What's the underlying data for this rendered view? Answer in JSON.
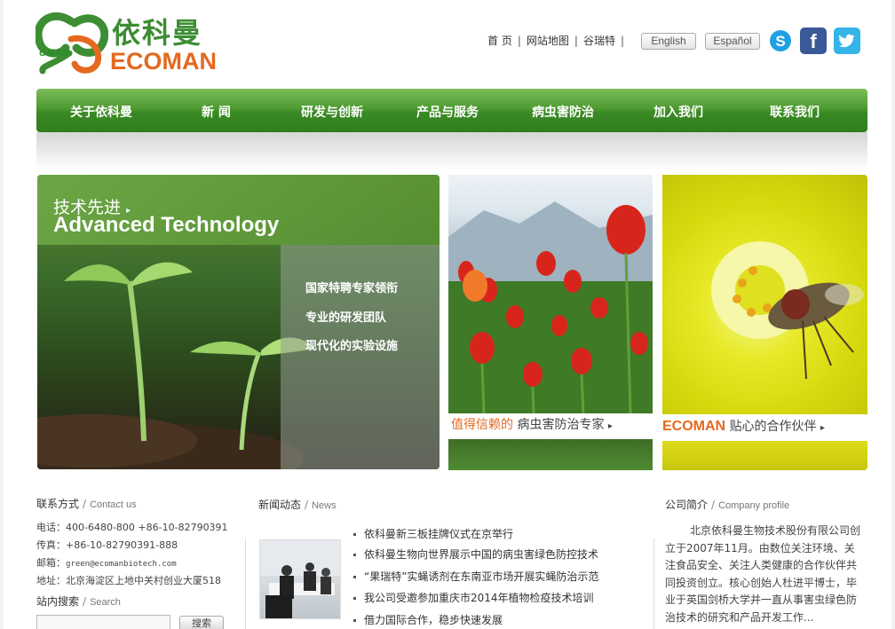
{
  "logo": {
    "cn": "依科曼",
    "en": "ECOMAN",
    "mark_text": "OMAN"
  },
  "toplinks": [
    {
      "label": "首 页"
    },
    {
      "label": "网站地图"
    },
    {
      "label": "谷瑞特"
    }
  ],
  "lang": {
    "english": "English",
    "espanol": "Español"
  },
  "social": {
    "facebook": "f"
  },
  "nav": [
    "关于依科曼",
    "新  闻",
    "研发与创新",
    "产品与服务",
    "病虫害防治",
    "加入我们",
    "联系我们"
  ],
  "banner1": {
    "title_cn": "技术先进",
    "title_en": "Advanced Technology",
    "bullets": [
      "国家特聘专家领衔",
      "专业的研发团队",
      "现代化的实验设施"
    ]
  },
  "banner2": {
    "highlight": "值得信赖的",
    "text": "病虫害防治专家"
  },
  "banner3": {
    "highlight": "ECOMAN",
    "text": "贴心的合作伙伴"
  },
  "contact": {
    "title": "联系方式",
    "title_en": "Contact us",
    "phone": "电话：400-6480-800    +86-10-82790391",
    "fax": "传真：+86-10-82790391-888",
    "email_label": "邮箱：",
    "email": "green@ecomanbiotech.com",
    "address": "地址：北京海淀区上地中关村创业大厦518"
  },
  "search": {
    "title": "站内搜索",
    "title_en": "Search",
    "button": "搜索"
  },
  "news": {
    "title": "新闻动态",
    "title_en": "News",
    "items": [
      "依科曼新三板挂牌仪式在京举行",
      "依科曼生物向世界展示中国的病虫害绿色防控技术",
      "“果瑞特”实蝇诱剂在东南亚市场开展实蝇防治示范",
      "我公司受邀参加重庆市2014年植物检疫技术培训",
      "借力国际合作，稳步快速发展"
    ]
  },
  "profile": {
    "title": "公司简介",
    "title_en": "Company profile",
    "text": "北京依科曼生物技术股份有限公司创立于2007年11月。由数位关注环境、关注食品安全、关注人类健康的合作伙伴共同投资创立。核心创始人杜进平博士，毕业于英国剑桥大学并一直从事害虫绿色防治技术的研究和产品开发工作..."
  },
  "colors": {
    "brand_green": "#3d8d32",
    "brand_orange": "#e4691f",
    "nav_green": "#4e9a32"
  }
}
